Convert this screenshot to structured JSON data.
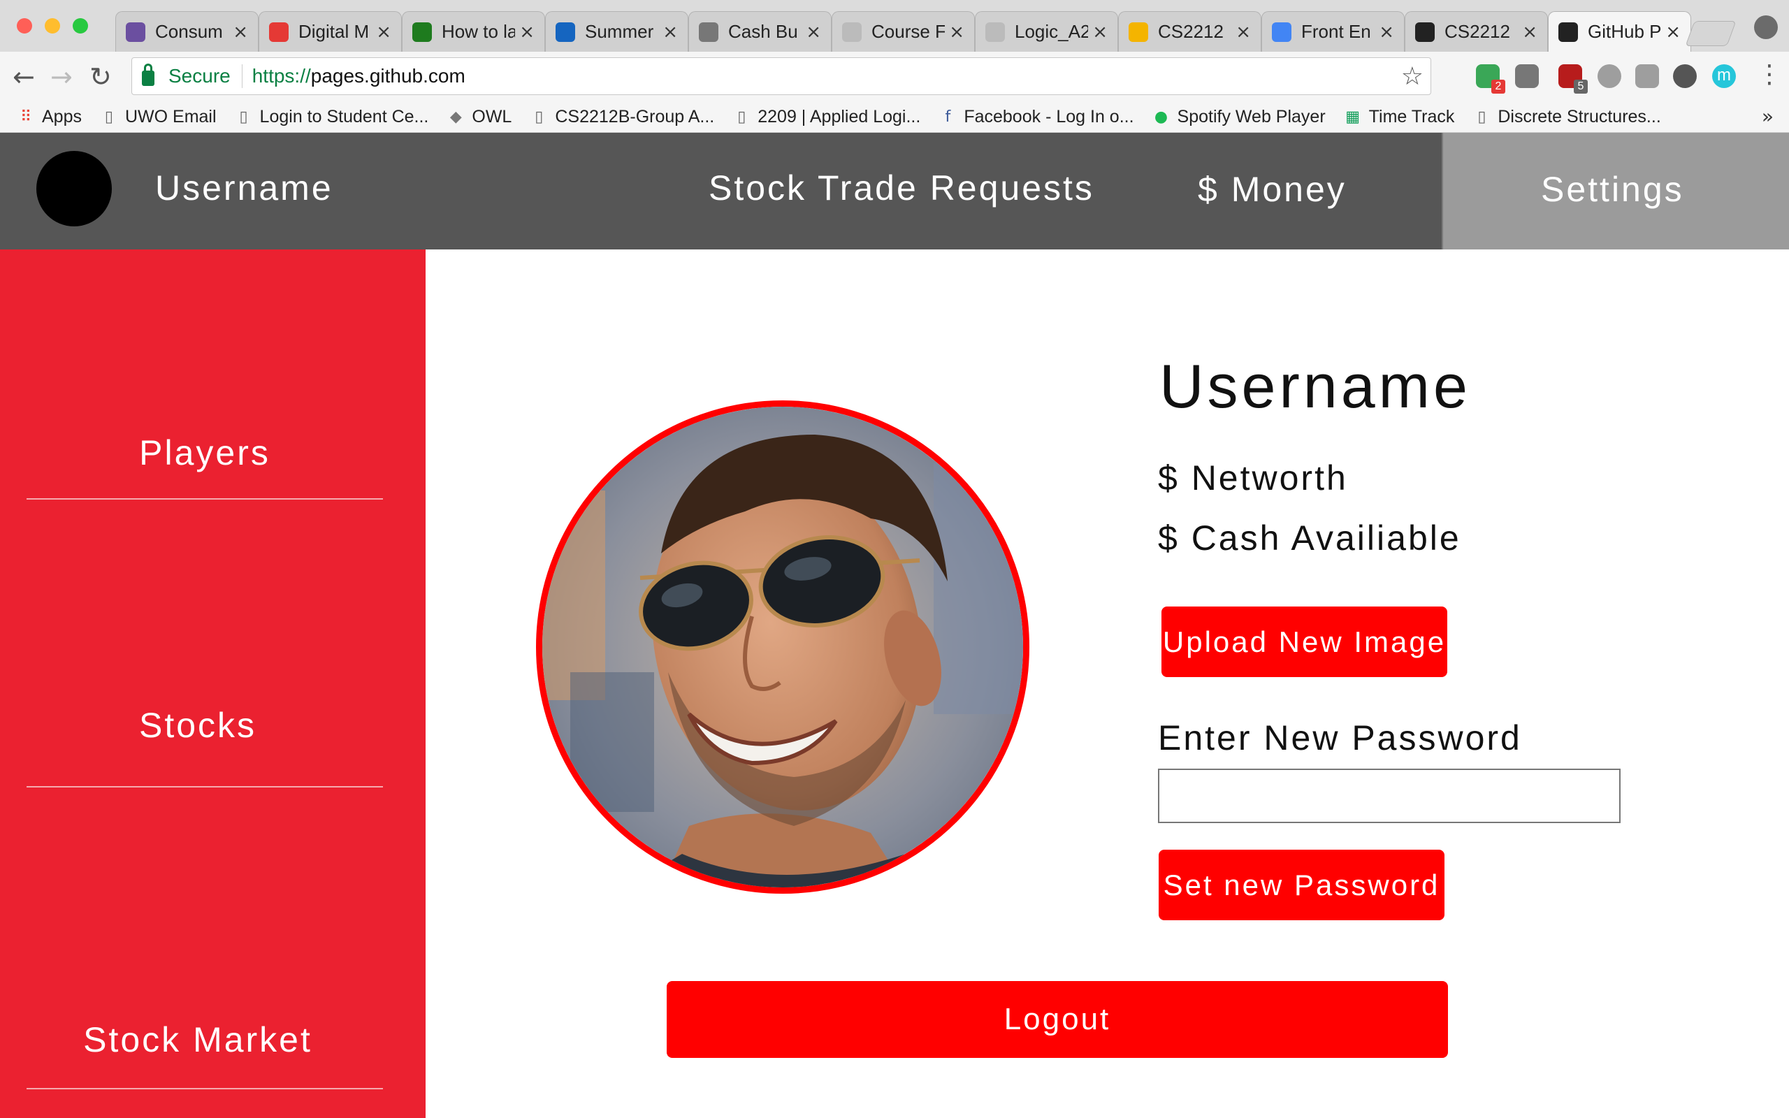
{
  "browser": {
    "traffic_lights": [
      "#ff5f57",
      "#ffbd2e",
      "#28c940"
    ],
    "tabs": [
      {
        "title": "Consum",
        "icon": "shield-icon",
        "color": "#6b4fa0"
      },
      {
        "title": "Digital M",
        "icon": "leaf-icon",
        "color": "#e53935"
      },
      {
        "title": "How to la",
        "icon": "code-icon",
        "color": "#1e7b1e"
      },
      {
        "title": "Summer",
        "icon": "bank-icon",
        "color": "#1565c0"
      },
      {
        "title": "Cash Bu",
        "icon": "mustang-icon",
        "color": "#777777"
      },
      {
        "title": "Course F",
        "icon": "page-icon",
        "color": "#bbbbbb"
      },
      {
        "title": "Logic_A2",
        "icon": "page-icon",
        "color": "#bbbbbb"
      },
      {
        "title": "CS2212",
        "icon": "drive-icon",
        "color": "#f4b400"
      },
      {
        "title": "Front En",
        "icon": "docs-icon",
        "color": "#4285f4"
      },
      {
        "title": "CS2212",
        "icon": "github-icon",
        "color": "#222222"
      },
      {
        "title": "GitHub P",
        "icon": "github-icon",
        "color": "#222222"
      }
    ],
    "close_glyph": "×",
    "secure_label": "Secure",
    "url_scheme": "https://",
    "url_host": "pages.github.com",
    "bookmarks": [
      {
        "label": "Apps",
        "icon": "apps-grid-icon"
      },
      {
        "label": "UWO Email",
        "icon": "page-icon"
      },
      {
        "label": "Login to Student Ce...",
        "icon": "page-icon"
      },
      {
        "label": "OWL",
        "icon": "mustang-icon"
      },
      {
        "label": "CS2212B-Group A...",
        "icon": "page-icon"
      },
      {
        "label": "2209 | Applied Logi...",
        "icon": "page-icon"
      },
      {
        "label": "Facebook - Log In o...",
        "icon": "facebook-icon"
      },
      {
        "label": "Spotify Web Player",
        "icon": "spotify-icon"
      },
      {
        "label": "Time Track",
        "icon": "sheets-icon"
      },
      {
        "label": "Discrete Structures...",
        "icon": "page-icon"
      }
    ],
    "bookmarks_more": "»",
    "extensions": [
      {
        "icon": "puzzle-icon",
        "color": "#3aa757",
        "badge": "2",
        "badge_color": "#e53935"
      },
      {
        "icon": "drive-ext-icon",
        "color": "#777777",
        "badge": "",
        "badge_color": ""
      },
      {
        "icon": "ublock-icon",
        "color": "#b71c1c",
        "badge": "5",
        "badge_color": "#666666"
      },
      {
        "icon": "power-icon",
        "color": "#9e9e9e",
        "badge": "",
        "badge_color": ""
      },
      {
        "icon": "recycle-icon",
        "color": "#9e9e9e",
        "badge": "",
        "badge_color": ""
      },
      {
        "icon": "color-wheel-icon",
        "color": "#555555",
        "badge": "",
        "badge_color": ""
      },
      {
        "icon": "m-circle-icon",
        "color": "#26c6da",
        "badge": "",
        "badge_color": ""
      }
    ],
    "ext_m_letter": "m"
  },
  "nav": {
    "username": "Username",
    "trade_requests": "Stock Trade Requests",
    "money": "$ Money",
    "settings": "Settings"
  },
  "sidebar": {
    "items": [
      {
        "label": "Players"
      },
      {
        "label": "Stocks"
      },
      {
        "label": "Stock Market"
      }
    ]
  },
  "profile": {
    "username": "Username",
    "networth": "$ Networth",
    "cash": "$ Cash Availiable",
    "upload_button": "Upload New Image",
    "password_label": "Enter New Password",
    "password_value": "",
    "set_password_button": "Set new Password",
    "logout_button": "Logout"
  },
  "colors": {
    "nav_bg": "#565656",
    "settings_bg": "#9b9b9b",
    "sidebar_bg": "#eb2130",
    "button_red": "#ff0000"
  }
}
